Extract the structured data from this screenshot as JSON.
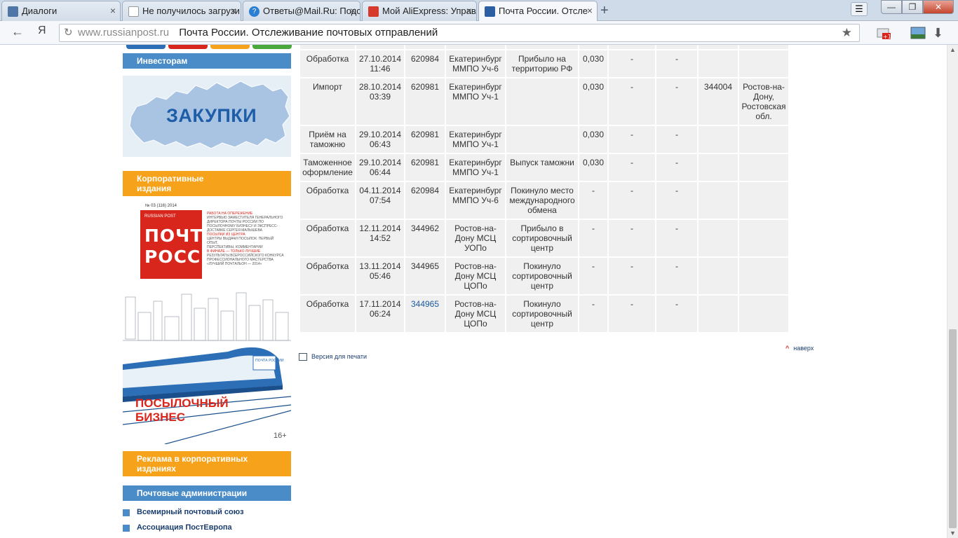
{
  "browser": {
    "tabs": [
      {
        "title": "Диалоги",
        "active": false,
        "favicon": "vk-icon"
      },
      {
        "title": "Не получилось загрузи",
        "active": false,
        "favicon": "document-icon"
      },
      {
        "title": "Ответы@Mail.Ru: Подс",
        "active": false,
        "favicon": "question-icon"
      },
      {
        "title": "Мой AliExpress: Управл",
        "active": false,
        "favicon": "aliexpress-icon"
      },
      {
        "title": "Почта России. Отсле",
        "active": true,
        "favicon": "russianpost-icon"
      }
    ],
    "new_tab": "+",
    "back": "←",
    "ya": "Я",
    "address_host": "www.russianpost.ru",
    "address_title": "Почта России. Отслеживание почтовых отправлений",
    "window_min": "—",
    "window_max": "❐",
    "window_close": "✕"
  },
  "sidebar": {
    "investors": "Инвесторам",
    "zakupki": "ЗАКУПКИ",
    "corporate_editions": [
      "Корпоративные",
      "издания"
    ],
    "magazine": {
      "number": "№ 03 (116) 2014",
      "brand": "RUSSIAN POST",
      "title_1": "ПОЧТА",
      "title_2": "РОССИИ",
      "lines": [
        {
          "text": "РАБОТА НА ОПЕРЕЖЕНИЕ",
          "red": true
        },
        {
          "text": "ИНТЕРВЬЮ ЗАМЕСТИТЕЛЯ ГЕНЕРАЛЬНОГО",
          "red": false
        },
        {
          "text": "ДИРЕКТОРА ПОЧТЫ РОССИИ ПО",
          "red": false
        },
        {
          "text": "ПОСЫЛОЧНОМУ БИЗНЕСУ И ЭКСПРЕСС-",
          "red": false
        },
        {
          "text": "ДОСТАВКЕ СЕРГЕЯ МАЛЫШЕВА",
          "red": false
        },
        {
          "text": "ПОСЫЛКИ ИЗ ЦЕНТРА",
          "red": true
        },
        {
          "text": "ЦЕНТРЫ ВЫДАЧИ ПОСЫЛОК: ПЕРВЫЙ ОПЫТ,",
          "red": false
        },
        {
          "text": "ПЕРСПЕКТИВЫ, КОММЕНТАРИИ",
          "red": false
        },
        {
          "text": "В ФИНАЛЕ — ТОЛЬКО ЛУЧШИЕ",
          "red": true
        },
        {
          "text": "РЕЗУЛЬТАТЫ ВСЕРОССИЙСКОГО КОНКУРСА",
          "red": false
        },
        {
          "text": "ПРОФЕССИОНАЛЬНОГО МАСТЕРСТВА",
          "red": false
        },
        {
          "text": "«ЛУЧШИЙ ПОЧТАЛЬОН — 2014»",
          "red": false
        }
      ]
    },
    "train_banner": {
      "line1": "ПОСЫЛОЧНЫЙ",
      "line2": "БИЗНЕС",
      "age": "16+",
      "train_label": "ПОЧТА РОССИИ"
    },
    "ads": [
      "Реклама в корпоративных",
      "изданиях"
    ],
    "postal_admin": "Почтовые администрации",
    "links": [
      "Всемирный почтовый союз",
      "Ассоциация ПостЕвропа"
    ]
  },
  "tracking": {
    "rows": [
      {
        "op": "Обработка",
        "date": "27.10.2014 11:46",
        "index": "620984",
        "place": "Екатеринбург ММПО Уч-6",
        "attr": "Прибыло на территорию РФ",
        "weight": "0,030",
        "c1": "-",
        "c2": "-",
        "rindex": "",
        "rplace": "",
        "link": false
      },
      {
        "op": "Импорт",
        "date": "28.10.2014 03:39",
        "index": "620981",
        "place": "Екатеринбург ММПО Уч-1",
        "attr": "",
        "weight": "0,030",
        "c1": "-",
        "c2": "-",
        "rindex": "344004",
        "rplace": "Ростов-на-Дону, Ростовская обл.",
        "link": false
      },
      {
        "op": "Приём на таможню",
        "date": "29.10.2014 06:43",
        "index": "620981",
        "place": "Екатеринбург ММПО Уч-1",
        "attr": "",
        "weight": "0,030",
        "c1": "-",
        "c2": "-",
        "rindex": "",
        "rplace": "",
        "link": false
      },
      {
        "op": "Таможенное оформление",
        "date": "29.10.2014 06:44",
        "index": "620981",
        "place": "Екатеринбург ММПО Уч-1",
        "attr": "Выпуск таможни",
        "weight": "0,030",
        "c1": "-",
        "c2": "-",
        "rindex": "",
        "rplace": "",
        "link": false
      },
      {
        "op": "Обработка",
        "date": "04.11.2014 07:54",
        "index": "620984",
        "place": "Екатеринбург ММПО Уч-6",
        "attr": "Покинуло место международного обмена",
        "weight": "-",
        "c1": "-",
        "c2": "-",
        "rindex": "",
        "rplace": "",
        "link": false
      },
      {
        "op": "Обработка",
        "date": "12.11.2014 14:52",
        "index": "344962",
        "place": "Ростов-на-Дону МСЦ УОПо",
        "attr": "Прибыло в сортировочный центр",
        "weight": "-",
        "c1": "-",
        "c2": "-",
        "rindex": "",
        "rplace": "",
        "link": false
      },
      {
        "op": "Обработка",
        "date": "13.11.2014 05:46",
        "index": "344965",
        "place": "Ростов-на-Дону МСЦ ЦОПо",
        "attr": "Покинуло сортировочный центр",
        "weight": "-",
        "c1": "-",
        "c2": "-",
        "rindex": "",
        "rplace": "",
        "link": false
      },
      {
        "op": "Обработка",
        "date": "17.11.2014 06:24",
        "index": "344965",
        "place": "Ростов-на-Дону МСЦ ЦОПо",
        "attr": "Покинуло сортировочный центр",
        "weight": "-",
        "c1": "-",
        "c2": "-",
        "rindex": "",
        "rplace": "",
        "link": true
      }
    ],
    "print_version": "Версия для печати",
    "to_top": "наверх"
  },
  "colors": {
    "blue_header": "#4a8cc7",
    "orange_header": "#f7a21b",
    "post_red": "#d9261c",
    "link": "#1b3d6e"
  }
}
